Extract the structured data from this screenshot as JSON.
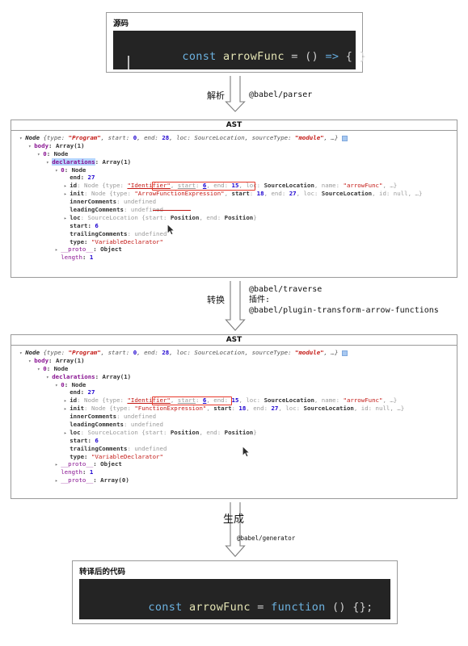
{
  "source_panel": {
    "title": "源码",
    "code": {
      "tokens": [
        {
          "t": "const",
          "c": "kw"
        },
        {
          "t": " ",
          "c": "pun"
        },
        {
          "t": "arrowFunc",
          "c": "var"
        },
        {
          "t": " = () ",
          "c": "pun"
        },
        {
          "t": "=>",
          "c": "arrw"
        },
        {
          "t": " { }",
          "c": "pun"
        }
      ],
      "plain": "const arrowFunc = () => { }"
    }
  },
  "arrow_parse": {
    "label": "解析",
    "annotation": "@babel/parser"
  },
  "ast_panel_1": {
    "header": "AST",
    "rows": [
      {
        "indent": 0,
        "tri": "▾",
        "parts": [
          {
            "t": "Node ",
            "c": "nodeital"
          },
          {
            "t": "{type: ",
            "c": "ital"
          },
          {
            "t": "\"Program\"",
            "c": "stri"
          },
          {
            "t": ", start: ",
            "c": "ital"
          },
          {
            "t": "0",
            "c": "num"
          },
          {
            "t": ", end: ",
            "c": "ital"
          },
          {
            "t": "28",
            "c": "num"
          },
          {
            "t": ", loc: ",
            "c": "ital"
          },
          {
            "t": "SourceLocation",
            "c": "ital"
          },
          {
            "t": ", sourceType: ",
            "c": "ital"
          },
          {
            "t": "\"module\"",
            "c": "stri"
          },
          {
            "t": ", …}",
            "c": "ital"
          }
        ],
        "badge": true
      },
      {
        "indent": 1,
        "tri": "▾",
        "parts": [
          {
            "t": "body",
            "c": "propb"
          },
          {
            "t": ": Array(1)",
            "c": "obj"
          }
        ]
      },
      {
        "indent": 2,
        "tri": "▾",
        "parts": [
          {
            "t": "0",
            "c": "propb"
          },
          {
            "t": ": Node",
            "c": "obj"
          }
        ]
      },
      {
        "indent": 3,
        "tri": "▾",
        "parts": [
          {
            "t": "declarations",
            "c": "propb hl"
          },
          {
            "t": ": Array(1)",
            "c": "obj"
          }
        ]
      },
      {
        "indent": 4,
        "tri": "▾",
        "parts": [
          {
            "t": "0",
            "c": "propb"
          },
          {
            "t": ": Node",
            "c": "obj"
          }
        ]
      },
      {
        "indent": 5,
        "tri": "",
        "parts": [
          {
            "t": "end",
            "c": "obj"
          },
          {
            "t": ": ",
            "c": "obj"
          },
          {
            "t": "27",
            "c": "num"
          }
        ]
      },
      {
        "indent": 5,
        "tri": "▸",
        "parts": [
          {
            "t": "id",
            "c": "obj"
          },
          {
            "t": ": Node ",
            "c": "gray"
          },
          {
            "t": "{type: ",
            "c": "gray"
          },
          {
            "t": "\"Identifier\"",
            "c": "str uline"
          },
          {
            "t": ", ",
            "c": "gray"
          },
          {
            "t": "start",
            "c": "gray uline"
          },
          {
            "t": ": ",
            "c": "gray"
          },
          {
            "t": "6",
            "c": "num uline"
          },
          {
            "t": ", end: ",
            "c": "gray"
          },
          {
            "t": "15",
            "c": "num"
          },
          {
            "t": ", loc: ",
            "c": "gray"
          },
          {
            "t": "SourceLocation",
            "c": "obj"
          },
          {
            "t": ", name: ",
            "c": "gray"
          },
          {
            "t": "\"arrowFunc\"",
            "c": "str"
          },
          {
            "t": ", …}",
            "c": "gray"
          }
        ]
      },
      {
        "indent": 5,
        "tri": "▸",
        "parts": [
          {
            "t": "init",
            "c": "obj"
          },
          {
            "t": ": Node ",
            "c": "gray"
          },
          {
            "t": "{type: ",
            "c": "gray"
          },
          {
            "t": "\"ArrowFunctionExpression\"",
            "c": "str"
          },
          {
            "t": ", ",
            "c": "gray"
          },
          {
            "t": "start",
            "c": "obj"
          },
          {
            "t": ": ",
            "c": "gray"
          },
          {
            "t": "18",
            "c": "num"
          },
          {
            "t": ", end: ",
            "c": "gray"
          },
          {
            "t": "27",
            "c": "num"
          },
          {
            "t": ", loc: ",
            "c": "gray"
          },
          {
            "t": "SourceLocation",
            "c": "obj"
          },
          {
            "t": ", id: ",
            "c": "gray"
          },
          {
            "t": "null",
            "c": "gray"
          },
          {
            "t": ", …}",
            "c": "gray"
          }
        ]
      },
      {
        "indent": 5,
        "tri": "",
        "parts": [
          {
            "t": "innerComments",
            "c": "obj"
          },
          {
            "t": ": ",
            "c": "gray"
          },
          {
            "t": "undefined",
            "c": "gray"
          }
        ]
      },
      {
        "indent": 5,
        "tri": "",
        "parts": [
          {
            "t": "leadingComments",
            "c": "obj"
          },
          {
            "t": ": ",
            "c": "gray"
          },
          {
            "t": "undefined",
            "c": "gray"
          }
        ]
      },
      {
        "indent": 5,
        "tri": "▸",
        "parts": [
          {
            "t": "loc",
            "c": "obj"
          },
          {
            "t": ": ",
            "c": "gray"
          },
          {
            "t": "SourceLocation ",
            "c": "gray"
          },
          {
            "t": "{start: ",
            "c": "gray"
          },
          {
            "t": "Position",
            "c": "obj"
          },
          {
            "t": ", end: ",
            "c": "gray"
          },
          {
            "t": "Position",
            "c": "obj"
          },
          {
            "t": "}",
            "c": "gray"
          }
        ]
      },
      {
        "indent": 5,
        "tri": "",
        "parts": [
          {
            "t": "start",
            "c": "obj"
          },
          {
            "t": ": ",
            "c": "obj"
          },
          {
            "t": "6",
            "c": "num"
          }
        ]
      },
      {
        "indent": 5,
        "tri": "",
        "parts": [
          {
            "t": "trailingComments",
            "c": "obj"
          },
          {
            "t": ": ",
            "c": "gray"
          },
          {
            "t": "undefined",
            "c": "gray"
          }
        ]
      },
      {
        "indent": 5,
        "tri": "",
        "parts": [
          {
            "t": "type",
            "c": "obj"
          },
          {
            "t": ": ",
            "c": "obj"
          },
          {
            "t": "\"VariableDeclarator\"",
            "c": "str"
          }
        ]
      },
      {
        "indent": 4,
        "tri": "▸",
        "parts": [
          {
            "t": "__proto__",
            "c": "prop"
          },
          {
            "t": ": Object",
            "c": "obj"
          }
        ]
      },
      {
        "indent": 4,
        "tri": "",
        "parts": [
          {
            "t": "length",
            "c": "prop"
          },
          {
            "t": ": ",
            "c": "obj"
          },
          {
            "t": "1",
            "c": "num"
          }
        ]
      }
    ]
  },
  "arrow_transform": {
    "label": "转换",
    "annotation_lines": [
      "@babel/traverse",
      "插件:",
      "@babel/plugin-transform-arrow-functions"
    ]
  },
  "ast_panel_2": {
    "header": "AST",
    "rows": [
      {
        "indent": 0,
        "tri": "▾",
        "parts": [
          {
            "t": "Node ",
            "c": "nodeital"
          },
          {
            "t": "{type: ",
            "c": "ital"
          },
          {
            "t": "\"Program\"",
            "c": "stri"
          },
          {
            "t": ", start: ",
            "c": "ital"
          },
          {
            "t": "0",
            "c": "num"
          },
          {
            "t": ", end: ",
            "c": "ital"
          },
          {
            "t": "28",
            "c": "num"
          },
          {
            "t": ", loc: ",
            "c": "ital"
          },
          {
            "t": "SourceLocation",
            "c": "ital"
          },
          {
            "t": ", sourceType: ",
            "c": "ital"
          },
          {
            "t": "\"module\"",
            "c": "stri"
          },
          {
            "t": ", …}",
            "c": "ital"
          }
        ],
        "badge": true
      },
      {
        "indent": 1,
        "tri": "▾",
        "parts": [
          {
            "t": "body",
            "c": "propb"
          },
          {
            "t": ": Array(1)",
            "c": "obj"
          }
        ]
      },
      {
        "indent": 2,
        "tri": "▾",
        "parts": [
          {
            "t": "0",
            "c": "propb"
          },
          {
            "t": ": Node",
            "c": "obj"
          }
        ]
      },
      {
        "indent": 3,
        "tri": "▾",
        "parts": [
          {
            "t": "declarations",
            "c": "propb"
          },
          {
            "t": ": Array(1)",
            "c": "obj"
          }
        ]
      },
      {
        "indent": 4,
        "tri": "▾",
        "parts": [
          {
            "t": "0",
            "c": "propb"
          },
          {
            "t": ": Node",
            "c": "obj"
          }
        ]
      },
      {
        "indent": 5,
        "tri": "",
        "parts": [
          {
            "t": "end",
            "c": "obj"
          },
          {
            "t": ": ",
            "c": "obj"
          },
          {
            "t": "27",
            "c": "num"
          }
        ]
      },
      {
        "indent": 5,
        "tri": "▸",
        "parts": [
          {
            "t": "id",
            "c": "obj"
          },
          {
            "t": ": Node ",
            "c": "gray"
          },
          {
            "t": "{type: ",
            "c": "gray"
          },
          {
            "t": "\"Identifier\"",
            "c": "str uline"
          },
          {
            "t": ", ",
            "c": "gray"
          },
          {
            "t": "start",
            "c": "gray uline"
          },
          {
            "t": ": ",
            "c": "gray"
          },
          {
            "t": "6",
            "c": "num uline"
          },
          {
            "t": ", end: ",
            "c": "gray"
          },
          {
            "t": "15",
            "c": "num"
          },
          {
            "t": ", loc: ",
            "c": "gray"
          },
          {
            "t": "SourceLocation",
            "c": "obj"
          },
          {
            "t": ", name: ",
            "c": "gray"
          },
          {
            "t": "\"arrowFunc\"",
            "c": "str"
          },
          {
            "t": ", …}",
            "c": "gray"
          }
        ]
      },
      {
        "indent": 5,
        "tri": "▸",
        "parts": [
          {
            "t": "init",
            "c": "obj"
          },
          {
            "t": ": Node ",
            "c": "gray"
          },
          {
            "t": "{type: ",
            "c": "gray"
          },
          {
            "t": "\"FunctionExpression\"",
            "c": "str"
          },
          {
            "t": ", ",
            "c": "gray"
          },
          {
            "t": "start",
            "c": "obj"
          },
          {
            "t": ": ",
            "c": "gray"
          },
          {
            "t": "18",
            "c": "num"
          },
          {
            "t": ", end: ",
            "c": "gray"
          },
          {
            "t": "27",
            "c": "num"
          },
          {
            "t": ", loc: ",
            "c": "gray"
          },
          {
            "t": "SourceLocation",
            "c": "obj"
          },
          {
            "t": ", id: ",
            "c": "gray"
          },
          {
            "t": "null",
            "c": "gray"
          },
          {
            "t": ", …}",
            "c": "gray"
          }
        ]
      },
      {
        "indent": 5,
        "tri": "",
        "parts": [
          {
            "t": "innerComments",
            "c": "obj"
          },
          {
            "t": ": ",
            "c": "gray"
          },
          {
            "t": "undefined",
            "c": "gray"
          }
        ]
      },
      {
        "indent": 5,
        "tri": "",
        "parts": [
          {
            "t": "leadingComments",
            "c": "obj"
          },
          {
            "t": ": ",
            "c": "gray"
          },
          {
            "t": "undefined",
            "c": "gray"
          }
        ]
      },
      {
        "indent": 5,
        "tri": "▸",
        "parts": [
          {
            "t": "loc",
            "c": "obj"
          },
          {
            "t": ": ",
            "c": "gray"
          },
          {
            "t": "SourceLocation ",
            "c": "gray"
          },
          {
            "t": "{start: ",
            "c": "gray"
          },
          {
            "t": "Position",
            "c": "obj"
          },
          {
            "t": ", end: ",
            "c": "gray"
          },
          {
            "t": "Position",
            "c": "obj"
          },
          {
            "t": "}",
            "c": "gray"
          }
        ]
      },
      {
        "indent": 5,
        "tri": "",
        "parts": [
          {
            "t": "start",
            "c": "obj"
          },
          {
            "t": ": ",
            "c": "obj"
          },
          {
            "t": "6",
            "c": "num"
          }
        ]
      },
      {
        "indent": 5,
        "tri": "",
        "parts": [
          {
            "t": "trailingComments",
            "c": "obj"
          },
          {
            "t": ": ",
            "c": "gray"
          },
          {
            "t": "undefined",
            "c": "gray"
          }
        ]
      },
      {
        "indent": 5,
        "tri": "",
        "parts": [
          {
            "t": "type",
            "c": "obj"
          },
          {
            "t": ": ",
            "c": "obj"
          },
          {
            "t": "\"VariableDeclarator\"",
            "c": "str"
          }
        ]
      },
      {
        "indent": 4,
        "tri": "▸",
        "parts": [
          {
            "t": "__proto__",
            "c": "prop"
          },
          {
            "t": ": Object",
            "c": "obj"
          }
        ]
      },
      {
        "indent": 4,
        "tri": "",
        "parts": [
          {
            "t": "length",
            "c": "prop"
          },
          {
            "t": ": ",
            "c": "obj"
          },
          {
            "t": "1",
            "c": "num"
          }
        ]
      },
      {
        "indent": 4,
        "tri": "▸",
        "parts": [
          {
            "t": "__proto__",
            "c": "prop"
          },
          {
            "t": ": Array(0)",
            "c": "obj"
          }
        ]
      }
    ]
  },
  "arrow_generate": {
    "label": "生成",
    "annotation": "@babel/generator"
  },
  "output_panel": {
    "title": "转译后的代码",
    "code": {
      "tokens": [
        {
          "t": "const",
          "c": "kw"
        },
        {
          "t": " ",
          "c": "pun"
        },
        {
          "t": "arrowFunc",
          "c": "var"
        },
        {
          "t": " = ",
          "c": "pun"
        },
        {
          "t": "function",
          "c": "kw"
        },
        {
          "t": " () {};",
          "c": "pun"
        }
      ],
      "plain": "const arrowFunc = function () {};"
    }
  },
  "colors": {
    "code_bg": "#242424",
    "keyword": "#6cb2e0",
    "identifier": "#e4e4b4",
    "punct": "#cfcfcf",
    "highlight_box": "#e8382a",
    "panel_border": "#9a9a9a",
    "string": "#c41a16",
    "number": "#1c00cf",
    "property": "#881391"
  }
}
